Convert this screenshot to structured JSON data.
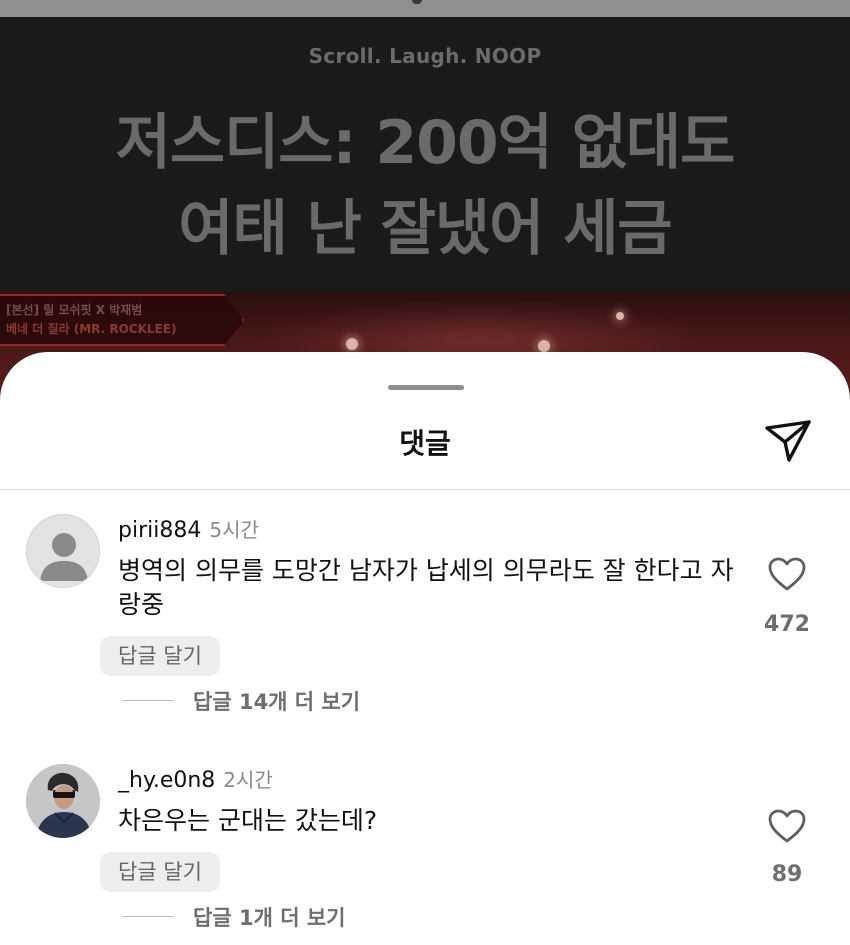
{
  "video": {
    "tagline": "Scroll. Laugh. NOOP",
    "headline_line1": "저스디스: 200억 없대도",
    "headline_line2": "여태 난 잘냈어 세금",
    "show_label_line1": "[본선] 릴 모쉬핏 X 박재범",
    "show_label_line2": "베네 더 질라 (MR. ROCKLEE)"
  },
  "sheet": {
    "title": "댓글",
    "share_icon": "paper-plane-icon"
  },
  "comments": [
    {
      "username": "pirii884",
      "time": "5시간",
      "text": "병역의 의무를 도망간 남자가 납세의 의무라도 잘 한다고 자랑중",
      "reply_label": "답글 달기",
      "more_replies": "답글 14개 더 보기",
      "likes": "472",
      "avatar": "default-avatar-icon"
    },
    {
      "username": "_hy.e0n8",
      "time": "2시간",
      "text": "차은우는 군대는 갔는데?",
      "reply_label": "답글 달기",
      "more_replies": "답글 1개 더 보기",
      "likes": "89",
      "avatar": "profile-photo"
    }
  ],
  "colors": {
    "background_dark": "#1a1a1a",
    "sheet_bg": "#ffffff",
    "muted_text": "#6e6e6e",
    "reply_btn_bg": "#eeeeee",
    "stage_red": "#5b1d1d"
  }
}
